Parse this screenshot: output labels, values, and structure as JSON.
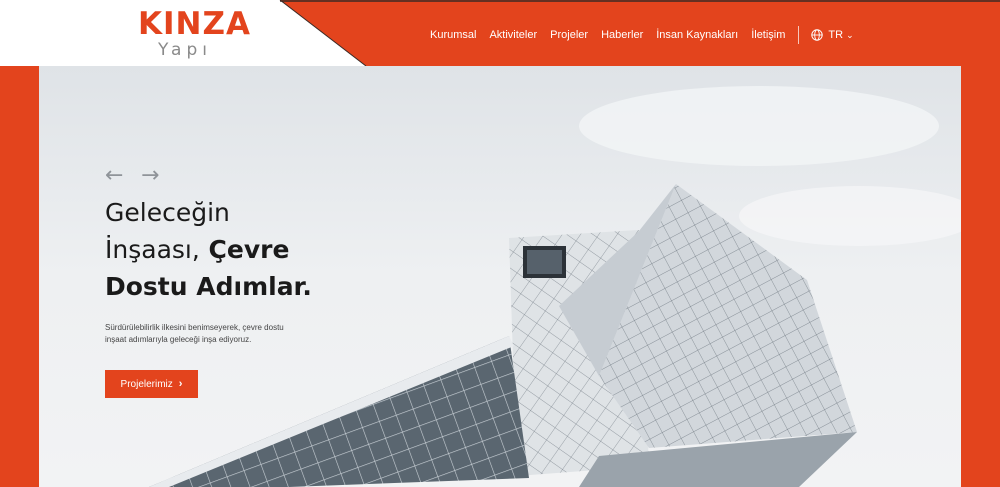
{
  "brand": {
    "name": "KINZA",
    "sub": "Yapı",
    "accent": "#e3441d"
  },
  "nav": {
    "items": [
      "Kurumsal",
      "Aktiviteler",
      "Projeler",
      "Haberler",
      "İnsan Kaynakları",
      "İletişim"
    ],
    "language": "TR",
    "language_icon": "globe-icon"
  },
  "hero": {
    "prev_icon": "arrow-left-icon",
    "next_icon": "arrow-right-icon",
    "headline_line1": "Geleceğin",
    "headline_line2_light": "İnşaası,",
    "headline_line2_bold": "Çevre",
    "headline_line3_bold": "Dostu Adımlar.",
    "description_line1": "Sürdürülebilirlik ilkesini benimseyerek, çevre dostu",
    "description_line2": "inşaat adımlarıyla geleceği inşa ediyoruz.",
    "cta_label": "Projelerimiz"
  }
}
